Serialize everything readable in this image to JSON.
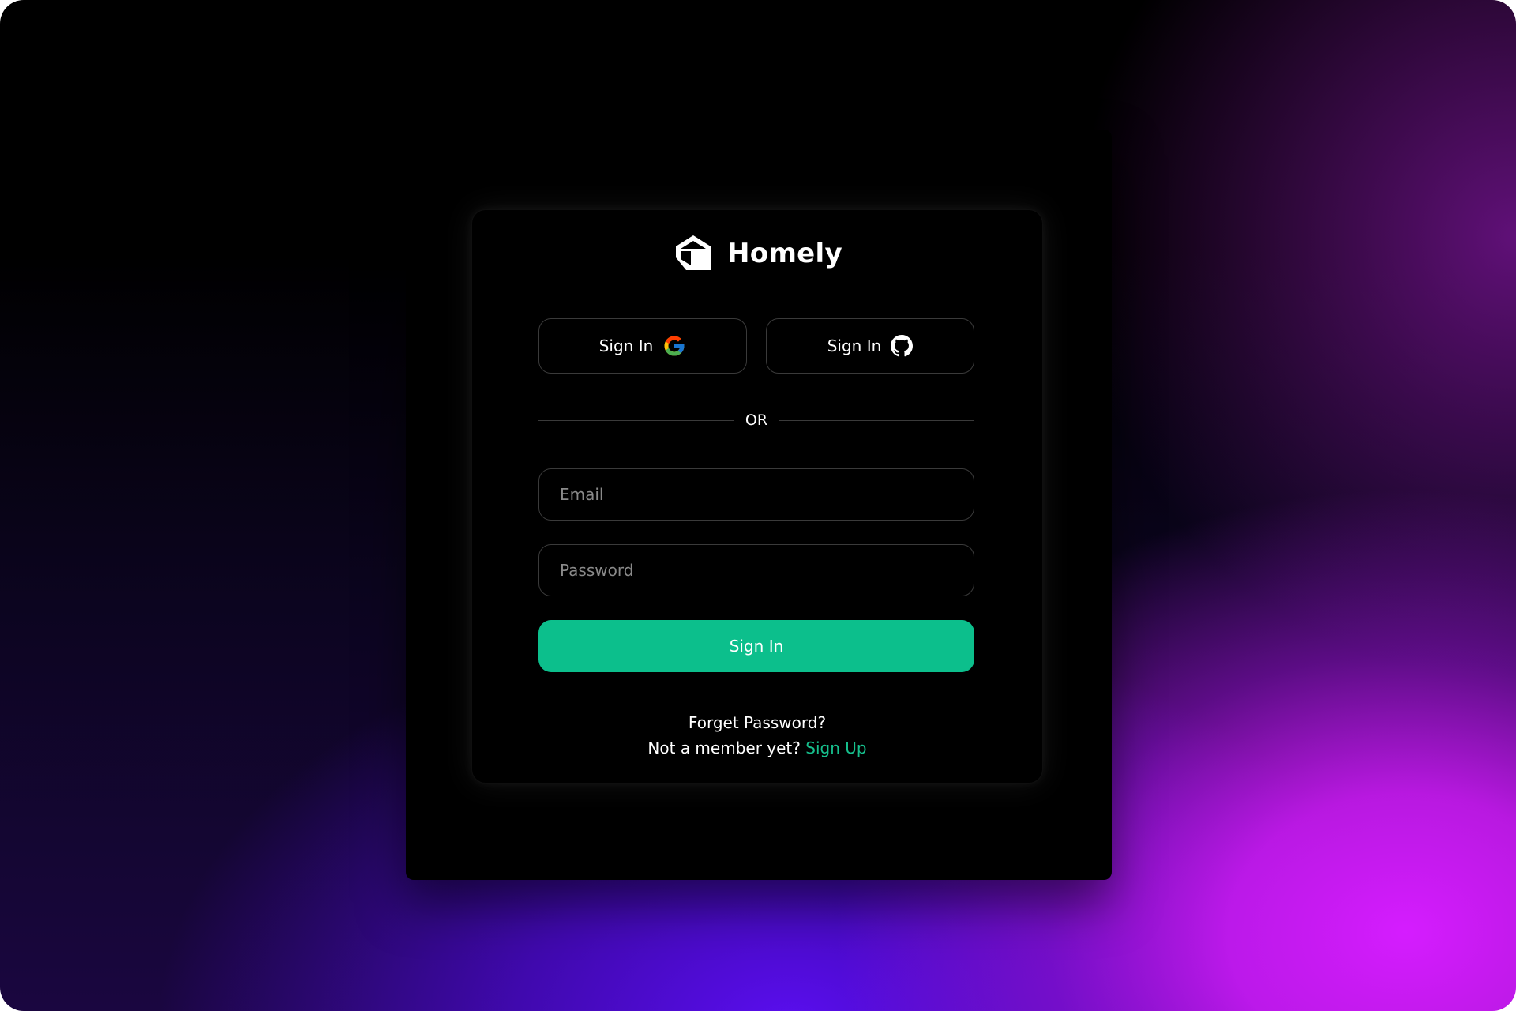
{
  "brand": {
    "name": "Homely",
    "logo_icon": "house-cube-icon"
  },
  "oauth": {
    "google": {
      "label": "Sign In",
      "icon": "google-icon"
    },
    "github": {
      "label": "Sign In",
      "icon": "github-icon"
    }
  },
  "divider": {
    "label": "OR"
  },
  "form": {
    "email": {
      "placeholder": "Email",
      "value": ""
    },
    "password": {
      "placeholder": "Password",
      "value": ""
    },
    "submit_label": "Sign In"
  },
  "links": {
    "forgot_password": "Forget Password?",
    "not_member": "Not a member yet?",
    "sign_up": "Sign Up"
  },
  "colors": {
    "accent": "#0cbf8c",
    "link": "#16c08d",
    "card_background": "#000000"
  }
}
